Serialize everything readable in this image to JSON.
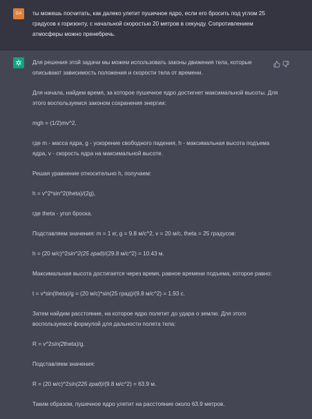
{
  "user": {
    "avatar_initials": "GA",
    "message": "ты можешь посчитать, как далеко улетит пушечное ядро, если его бросить под углом 25 градусов к горизонту, с начальной скоростью 20 метров в секунду. Сопротивлением атмосферы можно пренебречь."
  },
  "assistant": {
    "avatar_icon": "openai-logo-icon",
    "actions": [
      "thumbs-up-icon",
      "thumbs-down-icon"
    ],
    "p1": "Для решения этой задачи мы можем использовать законы движения тела, которые описывают зависимость положения и скорости тела от времени.",
    "p2": "Для начала, найдем время, за которое пушечное ядро достигнет максимальной высоты. Для этого воспользуемся законом сохранения энергии:",
    "p3": "mgh = (1/2)mv^2,",
    "p4": "где m - масса ядра, g - ускорение свободного падения, h - максимальная высота подъема ядра, v - скорость ядра на максимальной высоте.",
    "p5": "Решая уравнение относительно h, получаем:",
    "p6": "h = v^2*sin^2(theta)/(2g),",
    "p7": "где theta - угол броска.",
    "p8": "Подставляем значения: m = 1 кг, g = 9.8 м/с^2, v = 20 м/с, theta = 25 градусов:",
    "p9a": "h = (20 м/с)^2",
    "p9b": "sin^2(25 град)",
    "p9c": "/(29.8 м/с^2) = 10.43 м.",
    "p10": "Максимальная высота достигается через время, равное времени подъема, которое равно:",
    "p11": "t = v*sin(theta)/g = (20 м/с)*sin(25 град)/(9.8 м/с^2) = 1.93 с.",
    "p12": "Затем найдем расстояние, на которое ядро полетит до удара о землю. Для этого воспользуемся формулой для дальности полета тела:",
    "p13a": "R = v^2",
    "p13b": "sin(2",
    "p13c": "theta)/g.",
    "p14": "Подставляем значения:",
    "p15a": "R = (20 м/с)^2",
    "p15b": "sin(225 град)",
    "p15c": "/(9.8 м/с^2) = 63.9 м.",
    "p16": "Таким образом, пушечное ядро улетит на расстояние около 63.9 метров."
  }
}
